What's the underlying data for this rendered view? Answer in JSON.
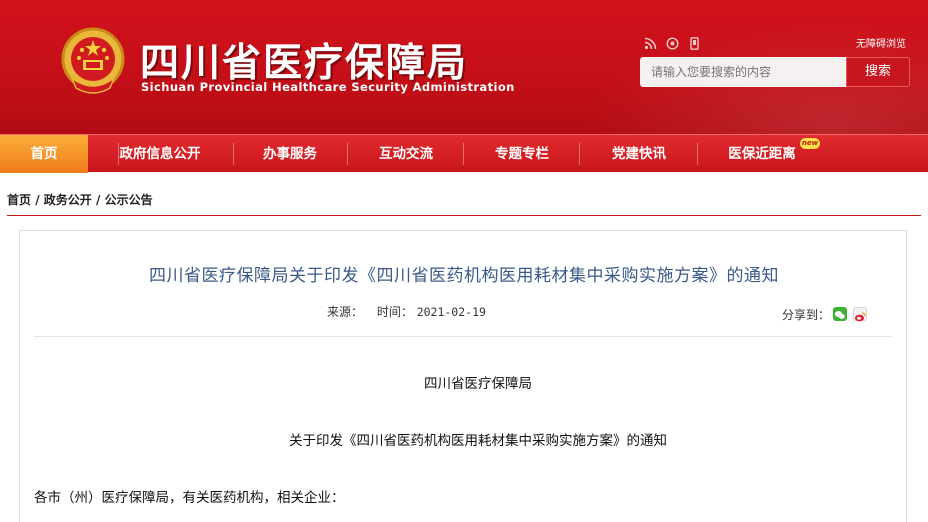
{
  "header": {
    "title": "四川省医疗保障局",
    "subtitle": "Sichuan Provincial Healthcare Security Administration",
    "accessible_label": "无障碍浏览",
    "icons": [
      "rss-icon",
      "weibo-icon",
      "mobile-icon"
    ],
    "search": {
      "placeholder": "请输入您要搜索的内容",
      "button_label": "搜索"
    },
    "colors": {
      "header_red": "#c50f18",
      "nav_red": "#d21a20",
      "active_orange": "#f39024"
    }
  },
  "nav": {
    "items": [
      {
        "label": "首页",
        "active": true
      },
      {
        "label": "政府信息公开",
        "active": false
      },
      {
        "label": "办事服务",
        "active": false
      },
      {
        "label": "互动交流",
        "active": false
      },
      {
        "label": "专题专栏",
        "active": false
      },
      {
        "label": "党建快讯",
        "active": false
      },
      {
        "label": "医保近距离",
        "active": false,
        "badge": "new"
      }
    ]
  },
  "breadcrumb": [
    "首页",
    "政务公开",
    "公示公告"
  ],
  "article": {
    "title": "四川省医疗保障局关于印发《四川省医药机构医用耗材集中采购实施方案》的通知",
    "source_label": "来源：",
    "time_label": "时间：",
    "date": "2021-02-19",
    "share_label": "分享到：",
    "body": {
      "org": "四川省医疗保障局",
      "subject": "关于印发《四川省医药机构医用耗材集中采购实施方案》的通知",
      "salutation": "各市（州）医疗保障局，有关医药机构，相关企业："
    }
  }
}
